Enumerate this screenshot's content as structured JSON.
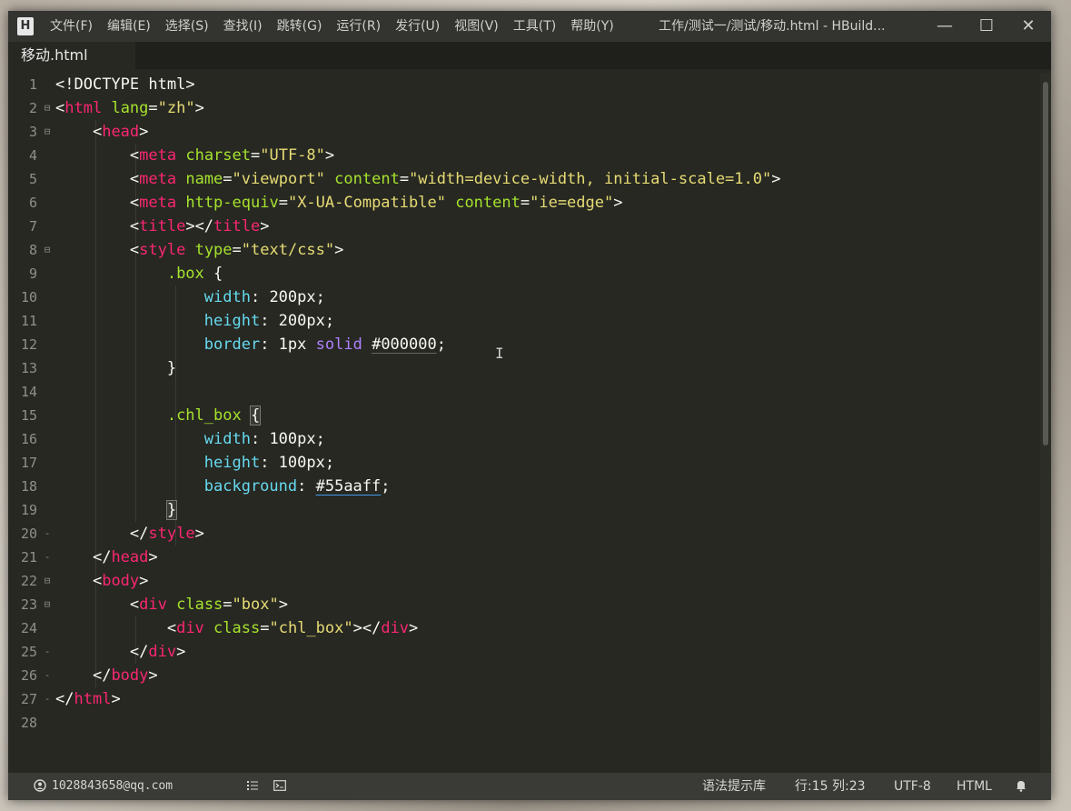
{
  "titlebar": {
    "logo": "H",
    "menu": [
      "文件(F)",
      "编辑(E)",
      "选择(S)",
      "查找(I)",
      "跳转(G)",
      "运行(R)",
      "发行(U)",
      "视图(V)",
      "工具(T)",
      "帮助(Y)"
    ],
    "window_title": "工作/测试一/测试/移动.html - HBuild...",
    "minimize": "—",
    "maximize": "☐",
    "close": "✕"
  },
  "tab": {
    "label": "移动.html"
  },
  "editor": {
    "lines": [
      {
        "n": "1",
        "fold": ""
      },
      {
        "n": "2",
        "fold": "⊟"
      },
      {
        "n": "3",
        "fold": "⊟"
      },
      {
        "n": "4",
        "fold": ""
      },
      {
        "n": "5",
        "fold": ""
      },
      {
        "n": "6",
        "fold": ""
      },
      {
        "n": "7",
        "fold": ""
      },
      {
        "n": "8",
        "fold": "⊟"
      },
      {
        "n": "9",
        "fold": ""
      },
      {
        "n": "10",
        "fold": ""
      },
      {
        "n": "11",
        "fold": ""
      },
      {
        "n": "12",
        "fold": ""
      },
      {
        "n": "13",
        "fold": ""
      },
      {
        "n": "14",
        "fold": ""
      },
      {
        "n": "15",
        "fold": ""
      },
      {
        "n": "16",
        "fold": ""
      },
      {
        "n": "17",
        "fold": ""
      },
      {
        "n": "18",
        "fold": ""
      },
      {
        "n": "19",
        "fold": ""
      },
      {
        "n": "20",
        "fold": "-"
      },
      {
        "n": "21",
        "fold": "-"
      },
      {
        "n": "22",
        "fold": "⊟"
      },
      {
        "n": "23",
        "fold": "⊟"
      },
      {
        "n": "24",
        "fold": ""
      },
      {
        "n": "25",
        "fold": "-"
      },
      {
        "n": "26",
        "fold": "-"
      },
      {
        "n": "27",
        "fold": "-"
      },
      {
        "n": "28",
        "fold": ""
      }
    ]
  },
  "statusbar": {
    "user_icon": "user-icon",
    "account": "1028843658@qq.com",
    "outline_icon": "list-icon",
    "terminal_icon": "terminal-icon",
    "syntax_lib": "语法提示库",
    "position": "行:15  列:23",
    "encoding": "UTF-8",
    "language": "HTML",
    "bell_icon": "bell-icon"
  },
  "colors": {
    "background": "#272822",
    "tag": "#f92672",
    "attr": "#a6e22e",
    "string": "#e6db74",
    "property": "#66d9ef",
    "keyword": "#ae81ff"
  }
}
